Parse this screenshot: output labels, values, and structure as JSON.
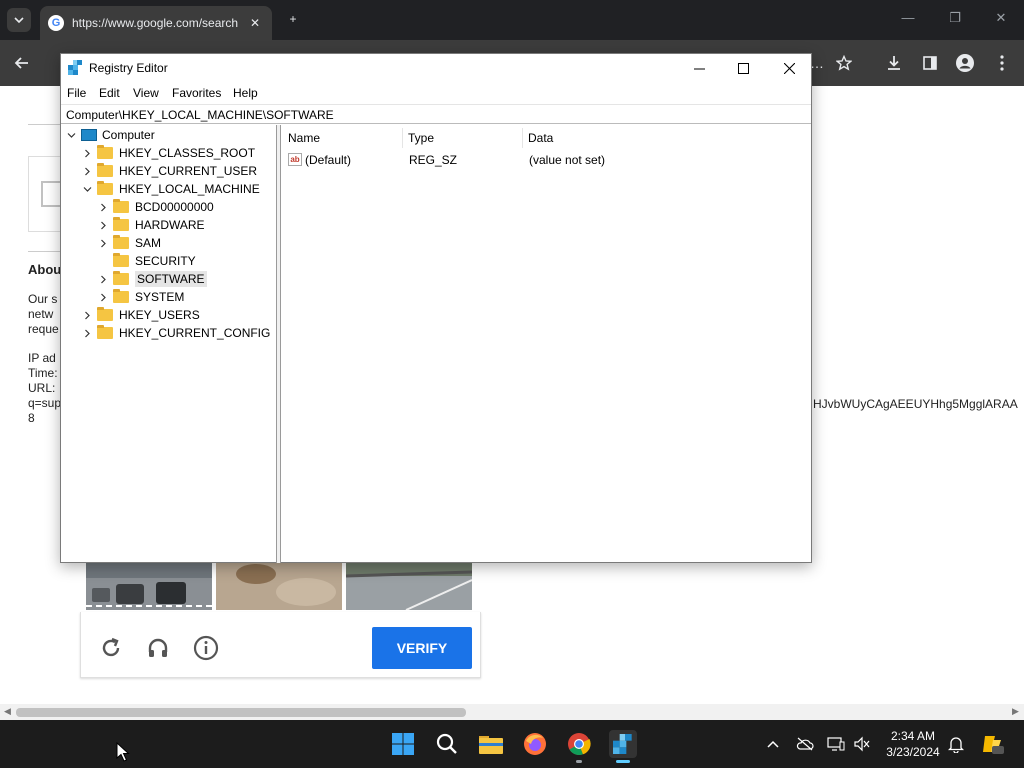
{
  "browser": {
    "tab_title": "https://www.google.com/search",
    "new_tab_glyph": "+",
    "toolbar_ellipsis": "…"
  },
  "page": {
    "about_fragment": "Abou",
    "body_lines": [
      "Our s",
      "netw",
      "reque"
    ],
    "info_lines": [
      "IP ad",
      "Time:",
      "URL:",
      "q=sup",
      "8"
    ],
    "url_tail": "HJvbWUyCAgAEEUYHhg5MgglARAA",
    "verify_label": "VERIFY"
  },
  "registry": {
    "title": "Registry Editor",
    "menu": [
      "File",
      "Edit",
      "View",
      "Favorites",
      "Help"
    ],
    "address": "Computer\\HKEY_LOCAL_MACHINE\\SOFTWARE",
    "tree": [
      {
        "label": "Computer",
        "level": 0,
        "expanded": true,
        "icon": "computer-icon"
      },
      {
        "label": "HKEY_CLASSES_ROOT",
        "level": 1,
        "expanded": false,
        "icon": "folder-icon"
      },
      {
        "label": "HKEY_CURRENT_USER",
        "level": 1,
        "expanded": false,
        "icon": "folder-icon"
      },
      {
        "label": "HKEY_LOCAL_MACHINE",
        "level": 1,
        "expanded": true,
        "icon": "folder-icon"
      },
      {
        "label": "BCD00000000",
        "level": 2,
        "expanded": false,
        "icon": "folder-icon"
      },
      {
        "label": "HARDWARE",
        "level": 2,
        "expanded": false,
        "icon": "folder-icon"
      },
      {
        "label": "SAM",
        "level": 2,
        "expanded": false,
        "icon": "folder-icon"
      },
      {
        "label": "SECURITY",
        "level": 2,
        "expanded": null,
        "icon": "folder-icon"
      },
      {
        "label": "SOFTWARE",
        "level": 2,
        "expanded": false,
        "icon": "folder-icon",
        "selected": true
      },
      {
        "label": "SYSTEM",
        "level": 2,
        "expanded": false,
        "icon": "folder-icon"
      },
      {
        "label": "HKEY_USERS",
        "level": 1,
        "expanded": false,
        "icon": "folder-icon"
      },
      {
        "label": "HKEY_CURRENT_CONFIG",
        "level": 1,
        "expanded": false,
        "icon": "folder-icon"
      }
    ],
    "columns": [
      "Name",
      "Type",
      "Data"
    ],
    "values": [
      {
        "name": "(Default)",
        "type": "REG_SZ",
        "data": "(value not set)"
      }
    ]
  },
  "taskbar": {
    "time": "2:34 AM",
    "date": "3/23/2024"
  },
  "colors": {
    "verify_blue": "#1a73e8",
    "folder_yellow": "#f5c542",
    "taskbar_bg": "#1c1c1c",
    "chrome_dark": "#202124"
  }
}
